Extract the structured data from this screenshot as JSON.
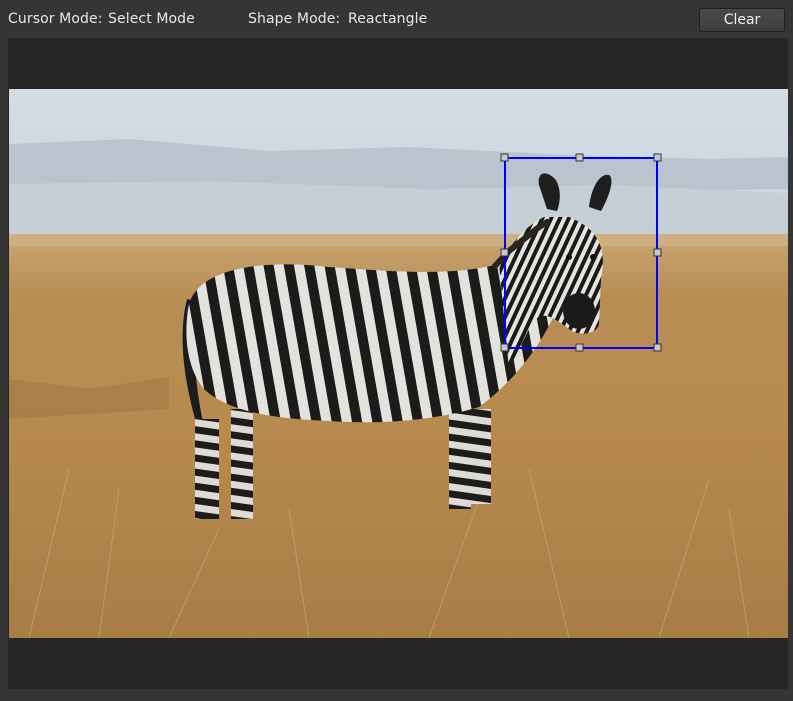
{
  "toolbar": {
    "cursor_mode_label": "Cursor Mode:",
    "cursor_mode_value": "Select Mode",
    "shape_mode_label": "Shape Mode:",
    "shape_mode_value": "Reactangle",
    "clear_label": "Clear"
  },
  "canvas": {
    "image_subject": "zebra-standing-in-dry-grassland",
    "selection_color": "#0000ff",
    "handle_color": "#c8c8c8",
    "shape_type": "rectangle"
  },
  "colors": {
    "window_bg": "#353535",
    "canvas_bg": "#262626",
    "text": "#e8e8e8"
  }
}
